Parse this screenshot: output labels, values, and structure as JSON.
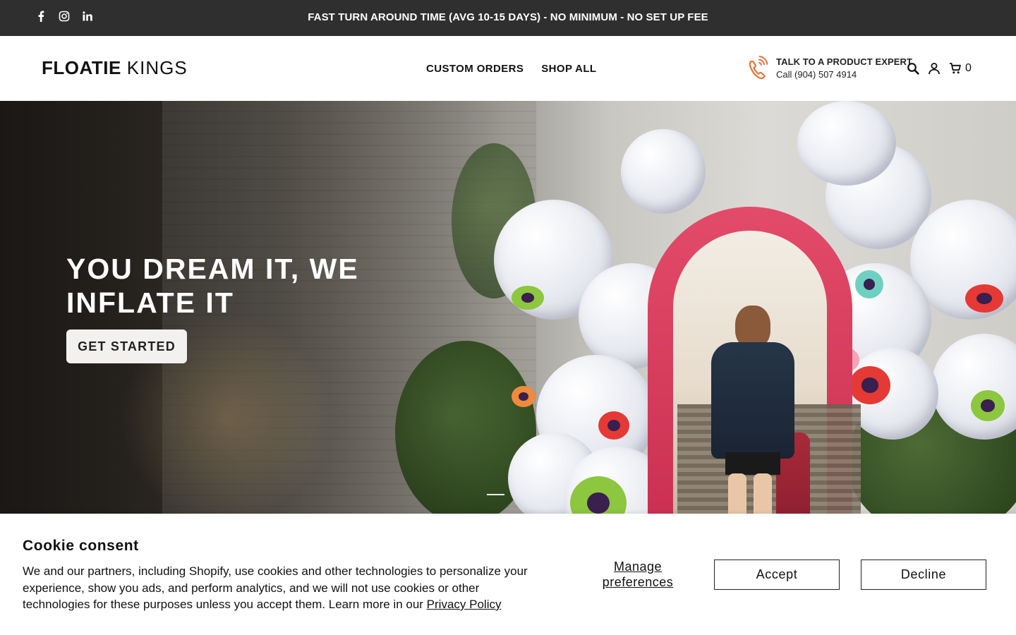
{
  "announcement": {
    "text": "FAST TURN AROUND TIME (AVG 10-15 DAYS) - NO MINIMUM - NO SET UP FEE",
    "social": [
      "facebook-icon",
      "instagram-icon",
      "linkedin-icon"
    ]
  },
  "header": {
    "logo_bold": "FLOATIE",
    "logo_light": "KINGS",
    "nav": [
      {
        "label": "CUSTOM ORDERS"
      },
      {
        "label": "SHOP ALL"
      }
    ],
    "expert_title": "TALK TO A PRODUCT EXPERT",
    "expert_phone": "Call (904) 507 4914",
    "cart_count": "0",
    "icons": [
      "phone-icon",
      "search-icon",
      "account-icon",
      "cart-icon"
    ],
    "accent_color": "#e8743b"
  },
  "hero": {
    "title": "YOU DREAM IT, WE INFLATE IT",
    "cta": "GET STARTED",
    "slide_count": 1
  },
  "cookie": {
    "title": "Cookie consent",
    "message": "We and our partners, including Shopify, use cookies and other technologies to personalize your experience, show you ads, and perform analytics, and we will not use cookies or other technologies for these purposes unless you accept them. Learn more in our ",
    "policy_link": "Privacy Policy",
    "manage": "Manage preferences",
    "accept": "Accept",
    "decline": "Decline"
  }
}
